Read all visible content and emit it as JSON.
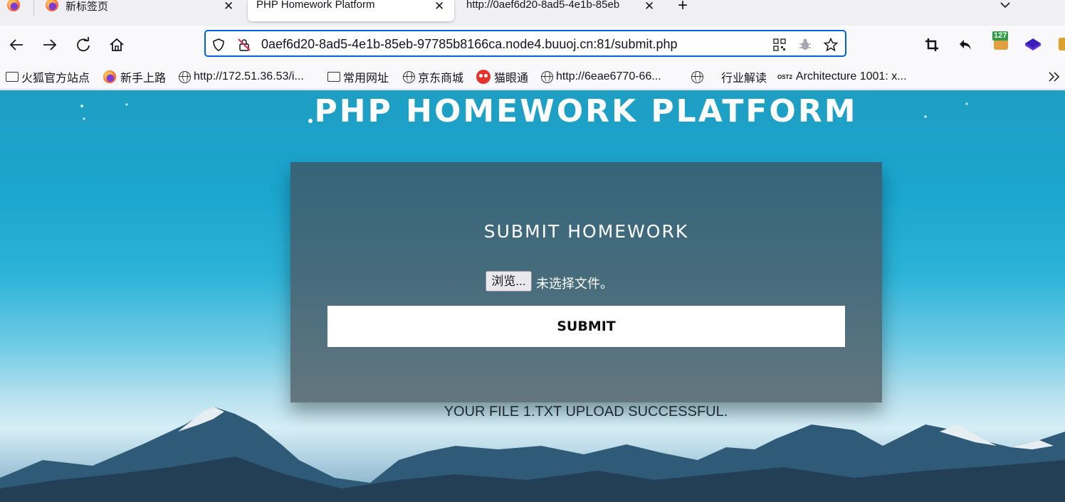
{
  "browser": {
    "tabs": [
      {
        "label": "新标签页",
        "active": false
      },
      {
        "label": "PHP Homework Platform",
        "active": true
      },
      {
        "label": "http://0aef6d20-8ad5-4e1b-85eb",
        "active": false
      }
    ],
    "new_tab_icon": "plus-icon",
    "list_tabs_icon": "chevron-down-icon",
    "url": "0aef6d20-8ad5-4e1b-85eb-97785b8166ca.node4.buuoj.cn:81/submit.php",
    "extension_badge": "127",
    "bookmarks": [
      {
        "label": "火狐官方站点",
        "icon": "folder-icon"
      },
      {
        "label": "新手上路",
        "icon": "firefox-icon"
      },
      {
        "label": "http://172.51.36.53/i...",
        "icon": "globe-icon"
      },
      {
        "label": "常用网址",
        "icon": "folder-icon"
      },
      {
        "label": "京东商城",
        "icon": "globe-icon"
      },
      {
        "label": "猫眼通",
        "icon": "cat-eye-icon"
      },
      {
        "label": "http://6eae6770-66...",
        "icon": "globe-icon"
      },
      {
        "label": "",
        "icon": "globe-icon"
      },
      {
        "label": "行业解读",
        "icon": "none"
      },
      {
        "label": "Architecture 1001: x...",
        "icon": "ost2-icon"
      }
    ],
    "ost2_label": "OST2",
    "accent_color": "#0061e0"
  },
  "page": {
    "title": "PHP HOMEWORK PLATFORM",
    "form": {
      "heading": "SUBMIT HOMEWORK",
      "browse_label": "浏览...",
      "file_status": "未选择文件。",
      "submit_label": "SUBMIT"
    },
    "result": "YOUR FILE 1.TXT UPLOAD SUCCESSFUL."
  }
}
